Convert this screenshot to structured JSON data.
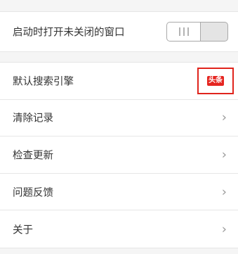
{
  "settings": {
    "restore_tabs": {
      "label": "启动时打开未关闭的窗口",
      "enabled": false
    },
    "search_engine": {
      "label": "默认搜索引擎",
      "logo_text": "头条",
      "logo_color": "#e52520"
    },
    "items": [
      {
        "label": "清除记录",
        "icon": "chevron-right-icon"
      },
      {
        "label": "检查更新",
        "icon": "chevron-right-icon"
      },
      {
        "label": "问题反馈",
        "icon": "chevron-right-icon"
      },
      {
        "label": "关于",
        "icon": "chevron-right-icon"
      }
    ]
  },
  "colors": {
    "background": "#f5f5f5",
    "highlight": "#e0241c",
    "text": "#333333",
    "chevron": "#9a9a9a"
  }
}
